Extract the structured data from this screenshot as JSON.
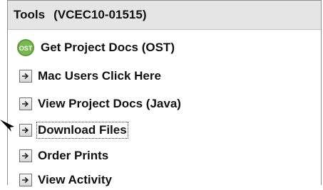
{
  "panel": {
    "title": "Tools",
    "code": "(VCEC10-01515)"
  },
  "items": [
    {
      "label": "Get Project Docs (OST)",
      "icon": "ost-icon"
    },
    {
      "label": "Mac Users Click Here",
      "icon": "arrow-right-icon"
    },
    {
      "label": "View Project Docs (Java)",
      "icon": "arrow-right-icon"
    },
    {
      "label": "Download Files",
      "icon": "arrow-right-icon",
      "focused": true
    },
    {
      "label": "Order Prints",
      "icon": "arrow-right-icon"
    },
    {
      "label": "View Activity",
      "icon": "arrow-right-icon"
    }
  ],
  "colors": {
    "header_bg": "#e5e5e5",
    "ost_green": "#5f9a3a"
  }
}
